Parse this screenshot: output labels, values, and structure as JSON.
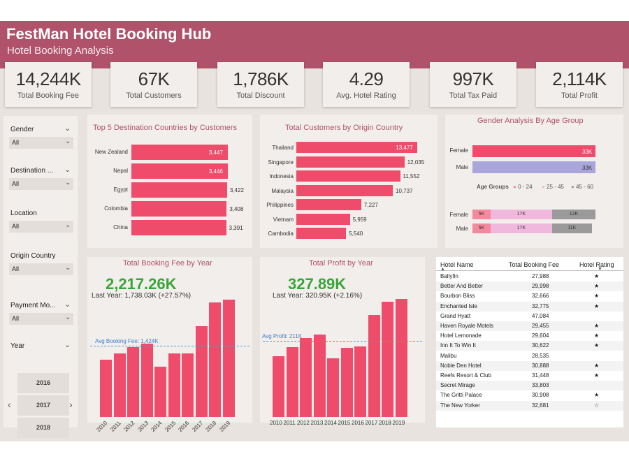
{
  "header": {
    "title": "FestMan Hotel Booking Hub",
    "subtitle": "Hotel Booking Analysis"
  },
  "kpis": [
    {
      "value": "14,244K",
      "label": "Total Booking Fee"
    },
    {
      "value": "67K",
      "label": "Total Customers"
    },
    {
      "value": "1,786K",
      "label": "Total Discount"
    },
    {
      "value": "4.29",
      "label": "Avg. Hotel Rating"
    },
    {
      "value": "997K",
      "label": "Total Tax Paid"
    },
    {
      "value": "2,114K",
      "label": "Total Profit"
    }
  ],
  "slicers": {
    "gender": {
      "title": "Gender",
      "value": "All"
    },
    "destination": {
      "title": "Destination ...",
      "value": "All"
    },
    "location": {
      "title": "Location",
      "value": "All"
    },
    "origin": {
      "title": "Origin Country",
      "value": "All"
    },
    "payment": {
      "title": "Payment Mo...",
      "value": "All"
    },
    "year": {
      "title": "Year",
      "options": [
        "2016",
        "2017",
        "2018"
      ]
    }
  },
  "icons": {
    "chevron_down": "chevron-down-icon",
    "arrow_left": "chevron-left-icon",
    "arrow_right": "chevron-right-icon",
    "star": "star-icon"
  },
  "colors": {
    "header": "#b0526a",
    "bar": "#ef4b6b",
    "male": "#a9a6dc",
    "age_0_24": "#f4899e",
    "age_25_45": "#f0b8dc",
    "age_45_60": "#9a9a9a",
    "highlight": "#3aa53a"
  },
  "chart_data": [
    {
      "type": "bar",
      "orientation": "horizontal",
      "title": "Top 5 Destination Countries by Customers",
      "categories": [
        "New Zealand",
        "Nepal",
        "Egypt",
        "Colombia",
        "China"
      ],
      "values": [
        3447,
        3446,
        3422,
        3408,
        3391
      ],
      "value_labels": [
        "3,447",
        "3,446",
        "3,422",
        "3,408",
        "3,391"
      ]
    },
    {
      "type": "bar",
      "orientation": "horizontal",
      "title": "Total Customers by Origin Country",
      "categories": [
        "Thailand",
        "Singapore",
        "Indonesia",
        "Malaysia",
        "Philippines",
        "Vietnam",
        "Cambodia"
      ],
      "values": [
        13477,
        12035,
        11552,
        10737,
        7227,
        5959,
        5540
      ],
      "value_labels": [
        "13,477",
        "12,035",
        "11,552",
        "10,737",
        "7,227",
        "5,959",
        "5,540"
      ]
    },
    {
      "type": "bar",
      "orientation": "horizontal",
      "title": "Gender Analysis By Age Group",
      "gender_totals": {
        "categories": [
          "Female",
          "Male"
        ],
        "values": [
          33,
          33
        ],
        "value_labels": [
          "33K",
          "33K"
        ]
      },
      "legend_title": "Age Groups",
      "legend": [
        "0 - 24",
        "25 - 45",
        "45 - 60"
      ],
      "stacked": {
        "categories": [
          "Female",
          "Male"
        ],
        "series": [
          {
            "name": "0 - 24",
            "values": [
              5,
              5
            ],
            "value_labels": [
              "5K",
              "5K"
            ]
          },
          {
            "name": "25 - 45",
            "values": [
              17,
              17
            ],
            "value_labels": [
              "17K",
              "17K"
            ]
          },
          {
            "name": "45 - 60",
            "values": [
              12,
              11
            ],
            "value_labels": [
              "12K",
              "11K"
            ]
          }
        ]
      }
    },
    {
      "type": "bar",
      "title": "Total Booking Fee by Year",
      "highlight_value": "2,217.26K",
      "comparison": "Last Year: 1,738.03K (+27.57%)",
      "avg_label": "Avg Booking Fee: 1,424K",
      "avg_value": 1424,
      "categories": [
        "2010",
        "2011",
        "2012",
        "2013",
        "2014",
        "2015",
        "2016",
        "2017",
        "2018",
        "2019"
      ],
      "values": [
        1140,
        1270,
        1400,
        1460,
        1000,
        1270,
        1270,
        1810,
        2280,
        2340
      ]
    },
    {
      "type": "bar",
      "title": "Total Profit by Year",
      "highlight_value": "327.89K",
      "comparison": "Last Year: 320.95K (+2.16%)",
      "avg_label": "Avg Profit: 211K",
      "avg_value": 211,
      "categories": [
        "2010",
        "2011",
        "2012",
        "2013",
        "2014",
        "2015",
        "2016",
        "2017",
        "2018",
        "2019"
      ],
      "values": [
        170,
        194,
        220,
        230,
        163,
        193,
        196,
        284,
        320,
        328
      ]
    },
    {
      "type": "table",
      "columns": [
        "Hotel Name",
        "Total Booking Fee",
        "Hotel Rating"
      ],
      "rows": [
        {
          "name": "Ballyfin",
          "fee": "27,988",
          "star": "full"
        },
        {
          "name": "Better And Better",
          "fee": "29,998",
          "star": "full"
        },
        {
          "name": "Bourbon Bliss",
          "fee": "32,666",
          "star": "full"
        },
        {
          "name": "Enchanted Isle",
          "fee": "32,775",
          "star": "full"
        },
        {
          "name": "Grand Hyatt",
          "fee": "47,084",
          "star": "none"
        },
        {
          "name": "Haven Royale Motels",
          "fee": "29,455",
          "star": "full"
        },
        {
          "name": "Hotel Lemonade",
          "fee": "29,604",
          "star": "full"
        },
        {
          "name": "Inn It To Win It",
          "fee": "30,622",
          "star": "full"
        },
        {
          "name": "Malibu",
          "fee": "28,535",
          "star": "none"
        },
        {
          "name": "Noble Den Hotel",
          "fee": "30,888",
          "star": "full"
        },
        {
          "name": "Reefs Resort & Club",
          "fee": "31,448",
          "star": "full"
        },
        {
          "name": "Secret Mirage",
          "fee": "33,803",
          "star": "none"
        },
        {
          "name": "The Gritti Palace",
          "fee": "30,908",
          "star": "full"
        },
        {
          "name": "The New Yorker",
          "fee": "32,681",
          "star": "half"
        }
      ]
    }
  ]
}
